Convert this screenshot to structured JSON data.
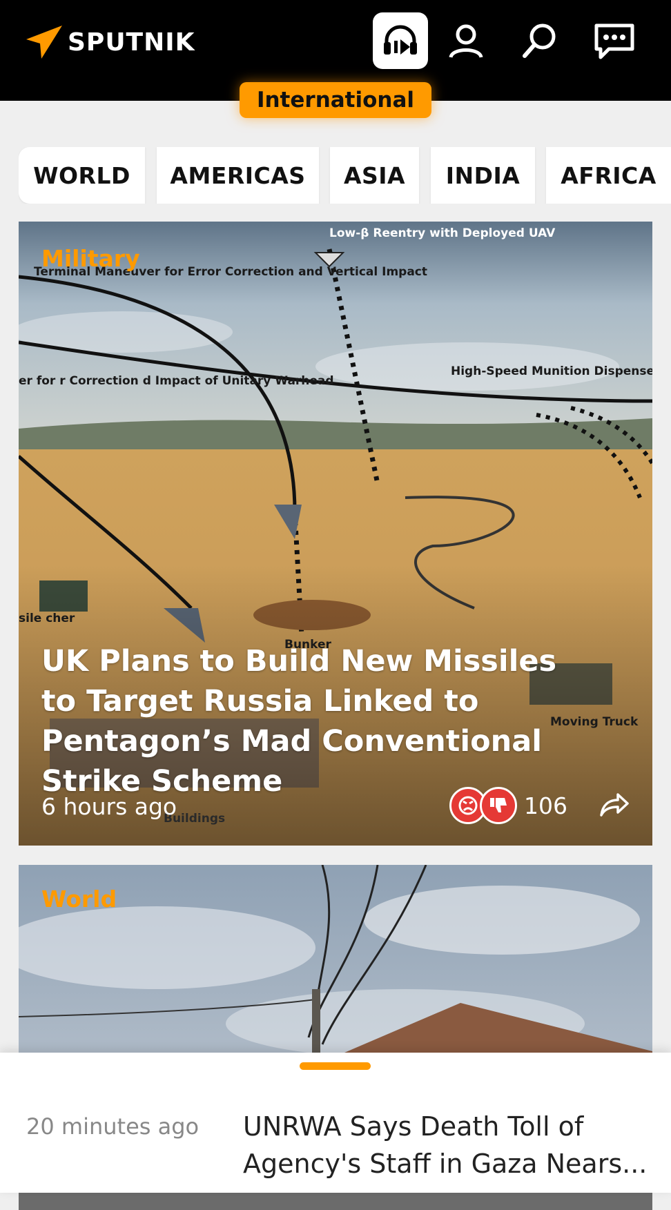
{
  "header": {
    "logo_text": "SPUTNIK",
    "edition": "International",
    "accent_color": "#ff9a00",
    "icons": [
      "radio-headphones-icon",
      "user-icon",
      "search-icon",
      "chat-icon"
    ]
  },
  "categories": [
    "WORLD",
    "AMERICAS",
    "ASIA",
    "INDIA",
    "AFRICA"
  ],
  "articles": [
    {
      "tag": "Military",
      "headline": "UK Plans to Build New Missiles to Target Russia Linked to Pentagon’s Mad Conventional Strike Scheme",
      "time": "6 hours ago",
      "reaction_count": "106",
      "image_labels": {
        "reentry": "Low-β Reentry with Deployed UAV",
        "terminal": "Terminal Maneuver for Error Correction and Vertical Impact",
        "left": "er for r Correction d Impact of Unitary Warhead",
        "highspeed": "High-Speed Munition Dispense from Gliding RV",
        "missile": "sile cher",
        "bunker": "Bunker",
        "moving": "Moving Truck",
        "buildings": "Buildings"
      }
    },
    {
      "tag": "World"
    }
  ],
  "latest": {
    "time": "20 minutes ago",
    "title": "UNRWA Says Death Toll of Agency's Staff in Gaza Nears..."
  }
}
